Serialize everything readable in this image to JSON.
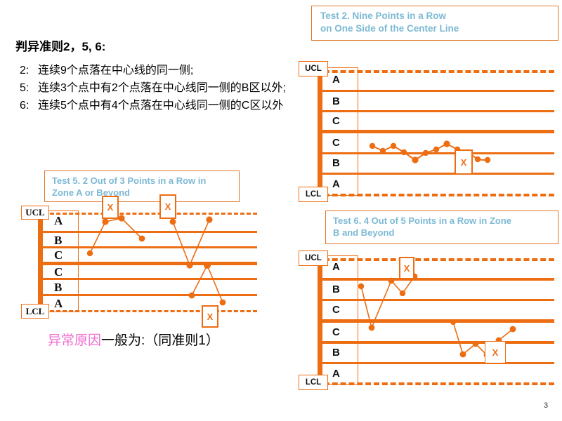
{
  "slide": {
    "page_number": "3",
    "heading": "判异准则2，5, 6:",
    "rules": [
      {
        "num": "2:",
        "text": "连续9个点落在中心线的同一侧;"
      },
      {
        "num": "5:",
        "text": "连续3个点中有2个点落在中心线同一侧的B区以外;"
      },
      {
        "num": "6:",
        "text": "连续5个点中有4个点落在中心线同一侧的C区以外"
      }
    ],
    "conclusion_pink": "异常原因",
    "conclusion_rest": "一般为:（同准则1）"
  },
  "colors": {
    "orange": "#ED6D13",
    "title_text": "#7cb9d4",
    "pink": "#f06ed0",
    "black": "#000000"
  },
  "charts": [
    {
      "id": "test2",
      "title": "Test 2. Nine Points in a Row\n on One Side of the Center Line",
      "title_lines": [
        "Test 2. Nine Points in a Row",
        " on One Side of the Center Line"
      ],
      "upper_limit_label": "UCL",
      "lower_limit_label": "LCL",
      "zone_letters": [
        "A",
        "B",
        "C",
        "C",
        "B",
        "A"
      ],
      "letter_style": "sans",
      "violation_marker": "X",
      "markers": [
        {
          "label": "X"
        }
      ]
    },
    {
      "id": "test5",
      "title": "Test 5. 2 Out of 3 Points in a Row in\nZone A or Beyond",
      "title_lines": [
        "Test 5. 2 Out of 3 Points in a Row in",
        "Zone A or Beyond"
      ],
      "upper_limit_label": "UCL",
      "lower_limit_label": "LCL",
      "zone_letters": [
        "A",
        "B",
        "C",
        "C",
        "B",
        "A"
      ],
      "letter_style": "serif",
      "violation_marker": "X",
      "markers": [
        {
          "label": "X"
        },
        {
          "label": "X"
        },
        {
          "label": "X"
        }
      ]
    },
    {
      "id": "test6",
      "title": "Test 6. 4 Out of 5 Points in a Row in Zone\nB and Beyond",
      "title_lines": [
        "Test 6. 4 Out of 5 Points in a Row in Zone",
        "B and Beyond"
      ],
      "upper_limit_label": "UCL",
      "lower_limit_label": "LCL",
      "zone_letters": [
        "A",
        "B",
        "C",
        "C",
        "B",
        "A"
      ],
      "letter_style": "sans",
      "violation_marker": "X",
      "markers": [
        {
          "label": "X"
        },
        {
          "label": "X"
        }
      ]
    }
  ],
  "chart_data": [
    {
      "id": "test2",
      "type": "line",
      "title": "Test 2. Nine Points in a Row on One Side of the Center Line",
      "xlabel": "",
      "ylabel": "",
      "grid": true,
      "legend": "none",
      "zones_top_to_bottom": [
        "A",
        "B",
        "C",
        "C",
        "B",
        "A"
      ],
      "control_limits": {
        "UCL": 6,
        "LCL": 0,
        "center": 3
      },
      "ylim": [
        0,
        6
      ],
      "x": [
        1,
        2,
        3,
        4,
        5,
        6,
        7,
        8,
        9,
        10,
        11,
        12,
        13
      ],
      "values": [
        2.72,
        2.48,
        2.72,
        2.42,
        2.05,
        2.38,
        2.55,
        2.75,
        2.55,
        2.42,
        2.08,
        2.06,
        2.06
      ],
      "annotations": [
        {
          "label": "X",
          "x": 12.4,
          "y": 2.05,
          "note": "nine consecutive points below center line"
        }
      ]
    },
    {
      "id": "test5",
      "type": "line",
      "title": "Test 5. 2 Out of 3 Points in a Row in Zone A or Beyond",
      "xlabel": "",
      "ylabel": "",
      "grid": true,
      "legend": "none",
      "zones_top_to_bottom": [
        "A",
        "B",
        "C",
        "C",
        "B",
        "A"
      ],
      "control_limits": {
        "UCL": 6,
        "LCL": 0,
        "center": 3
      },
      "ylim": [
        0,
        6
      ],
      "x": [
        1,
        2,
        3,
        4,
        5,
        6,
        7,
        8
      ],
      "values": [
        4.15,
        5.62,
        5.78,
        4.92,
        5.7,
        2.85,
        5.72,
        2.8
      ],
      "extra_points": [
        {
          "x": 9,
          "y": 2.82
        },
        {
          "x": 10,
          "y": 1.05
        },
        {
          "x": 11,
          "y": 0.72
        }
      ],
      "annotations": [
        {
          "label": "X",
          "x": 3,
          "y": 5.78,
          "note": "2 of 3 in Zone A above"
        },
        {
          "label": "X",
          "x": 7,
          "y": 5.72,
          "note": "2 of 3 in Zone A above"
        },
        {
          "label": "X",
          "x": 11,
          "y": 0.72,
          "note": "2 of 3 in Zone A below"
        }
      ]
    },
    {
      "id": "test6",
      "type": "line",
      "title": "Test 6. 4 Out of 5 Points in a Row in Zone B and Beyond",
      "xlabel": "",
      "ylabel": "",
      "grid": true,
      "legend": "none",
      "zones_top_to_bottom": [
        "A",
        "B",
        "C",
        "C",
        "B",
        "A"
      ],
      "control_limits": {
        "UCL": 6,
        "LCL": 0,
        "center": 3
      },
      "ylim": [
        0,
        6
      ],
      "x": [
        1,
        2,
        3,
        4,
        5,
        6,
        7,
        8,
        9,
        10,
        11
      ],
      "values": [
        4.58,
        2.62,
        4.72,
        4.38,
        5.02,
        2.95,
        1.62,
        2.05,
        1.6,
        2.02,
        2.48
      ],
      "annotations": [
        {
          "label": "X",
          "x": 5,
          "y": 5.02,
          "note": "4 of 5 in Zone B and beyond above"
        },
        {
          "label": "X",
          "x": 9.6,
          "y": 1.85,
          "note": "4 of 5 in Zone B and beyond below"
        }
      ]
    }
  ]
}
